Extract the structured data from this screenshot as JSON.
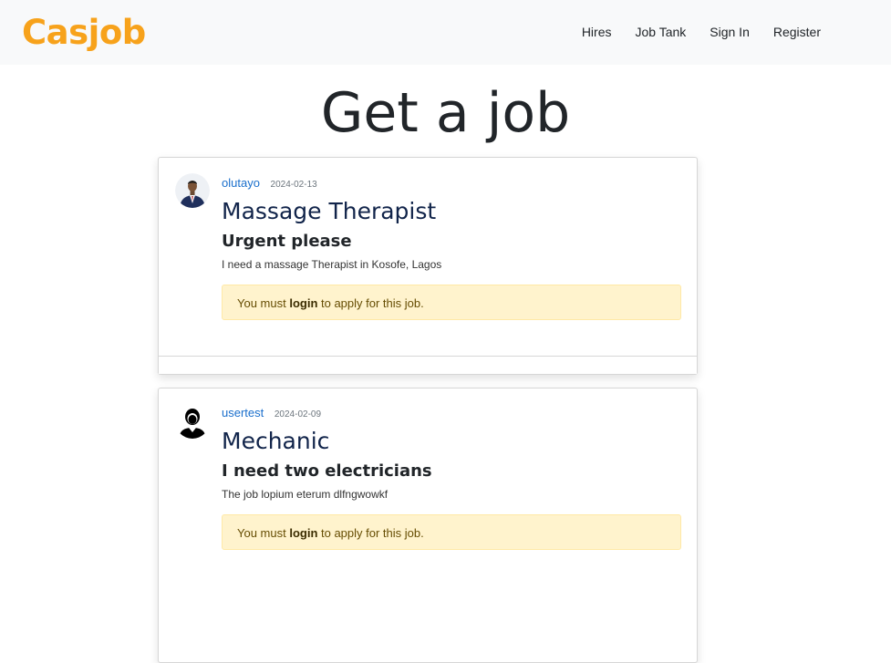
{
  "navbar": {
    "brand": "Casjob",
    "links": [
      "Hires",
      "Job Tank",
      "Sign In",
      "Register"
    ]
  },
  "main": {
    "title": "Get a job",
    "jobs": [
      {
        "author": "olutayo",
        "date": "2024-02-13",
        "title": "Massage Therapist",
        "subtitle": "Urgent please",
        "description": "I need a massage Therapist in Kosofe, Lagos",
        "notice": {
          "prefix": "You must ",
          "link": "login",
          "suffix": " to apply for this job."
        }
      },
      {
        "author": "usertest",
        "date": "2024-02-09",
        "title": "Mechanic",
        "subtitle": "I need two electricians",
        "description": "The job lopium eterum dlfngwowkf",
        "notice": {
          "prefix": "You must ",
          "link": "login",
          "suffix": " to apply for this job."
        }
      }
    ]
  },
  "colors": {
    "brand": "#f7a21b",
    "link": "#1a6fcc",
    "alert_bg": "#fff3cd"
  },
  "icons": {
    "avatar_1": "person-photo-icon",
    "avatar_2": "user-silhouette-icon"
  }
}
